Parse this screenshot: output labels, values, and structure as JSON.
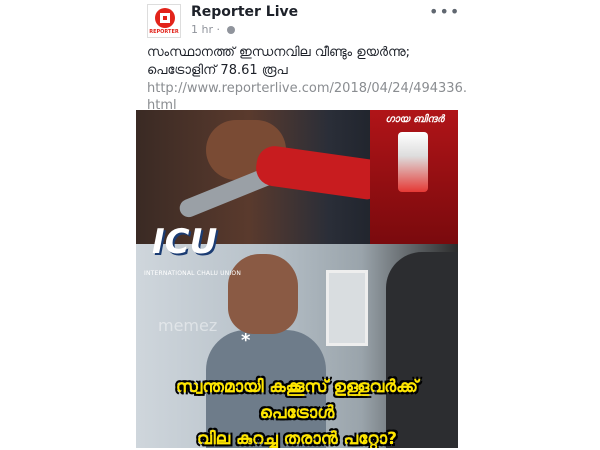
{
  "post": {
    "page_name": "Reporter Live",
    "time": "1 hr",
    "privacy_icon": "globe-icon",
    "more_icon": "more-options-icon",
    "text": "സംസ്ഥാനത്ത് ഇന്ധനവില വീണ്ടും ഉയർന്നു; പെട്രോളിന് 78.61 രൂപ",
    "link": "http://www.reporterlive.com/2018/04/24/494336.html"
  },
  "avatar": {
    "label": "REPORTER"
  },
  "meme": {
    "top_watermark": "ഗായ ബിന്ദർ",
    "badge_logo": "ICU",
    "badge_text": "INTERNATIONAL CHALU UNION",
    "mid_watermark": "memez",
    "asterisk": "*",
    "caption_line1": "സ്വന്തമായി കക്കൂസ് ഉള്ളവർക്ക് പെട്രോൾ",
    "caption_line2": "വില കുറച്ചു  തരാൻ പറ്റോ?"
  },
  "colors": {
    "brand_red": "#e2231a",
    "caption_yellow": "#ffe600",
    "link_gray": "#8a8d91"
  }
}
